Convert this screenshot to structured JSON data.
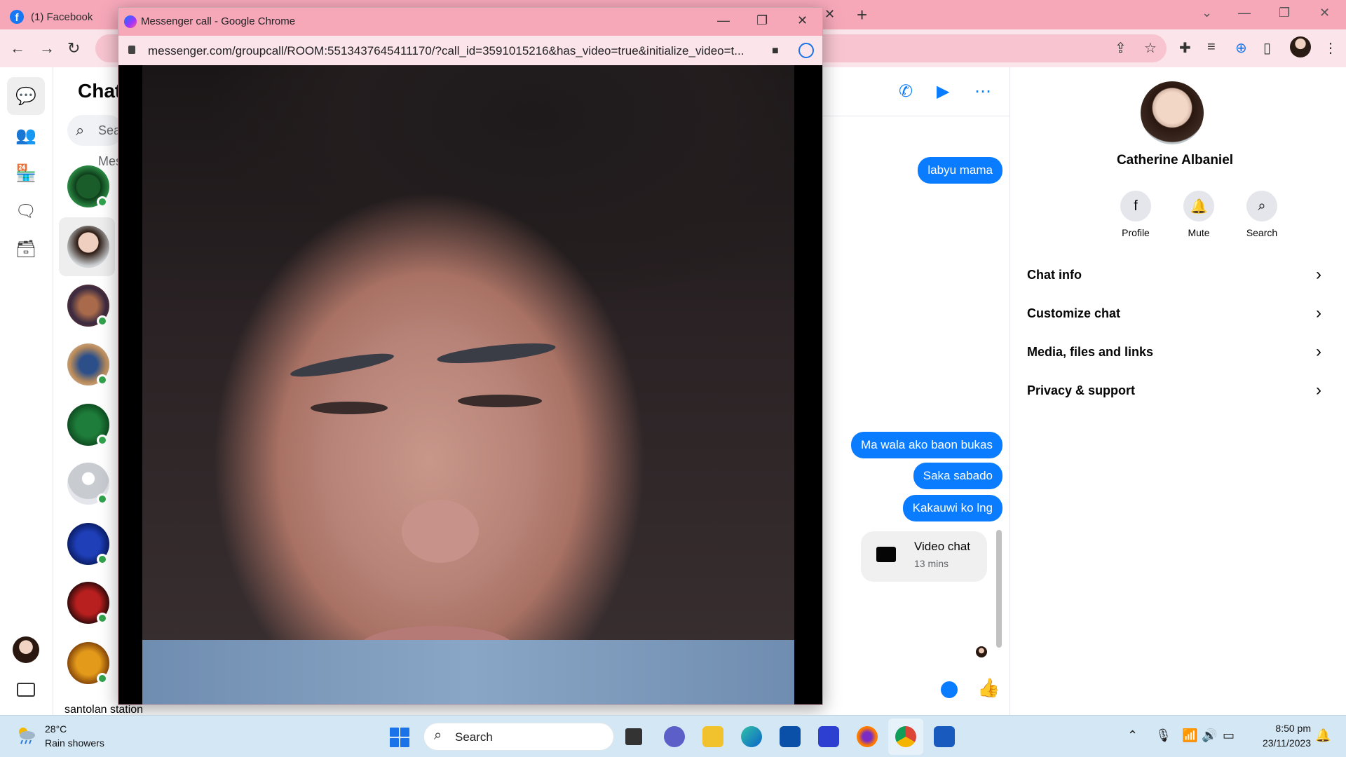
{
  "browser": {
    "tab_title": "(1) Facebook",
    "new_tab": "+",
    "window_controls": {
      "minimize": "—",
      "maximize": "❐",
      "close": "✕"
    },
    "tab_close": "✕"
  },
  "nav": {
    "back": "←",
    "forward": "→",
    "reload": "↻"
  },
  "sidebar_rail": {
    "items": [
      "chats-icon",
      "people-icon",
      "marketplace-icon",
      "requests-icon",
      "archive-icon"
    ]
  },
  "chat_list": {
    "title": "Chats",
    "search_placeholder": "Search Messenger",
    "partial_item": "santolan station"
  },
  "conversation": {
    "messages": [
      "labyu mama",
      "Ma wala ako baon bukas",
      "Saka sabado",
      "Kakauwi ko lng"
    ],
    "video_chat": {
      "title": "Video chat",
      "duration": "13 mins"
    },
    "accent_color": "#0a7cff"
  },
  "info_panel": {
    "name": "Catherine Albaniel",
    "actions": [
      {
        "label": "Profile",
        "icon": "facebook-icon"
      },
      {
        "label": "Mute",
        "icon": "bell-icon"
      },
      {
        "label": "Search",
        "icon": "search-icon"
      }
    ],
    "rows": [
      "Chat info",
      "Customize chat",
      "Media, files and links",
      "Privacy & support"
    ]
  },
  "call_popup": {
    "title": "Messenger call - Google Chrome",
    "url": "messenger.com/groupcall/ROOM:5513437645411170/?call_id=3591015216&has_video=true&initialize_video=t..."
  },
  "taskbar": {
    "weather_temp": "28°C",
    "weather_desc": "Rain showers",
    "search_label": "Search",
    "time": "8:50 pm",
    "date": "23/11/2023"
  }
}
